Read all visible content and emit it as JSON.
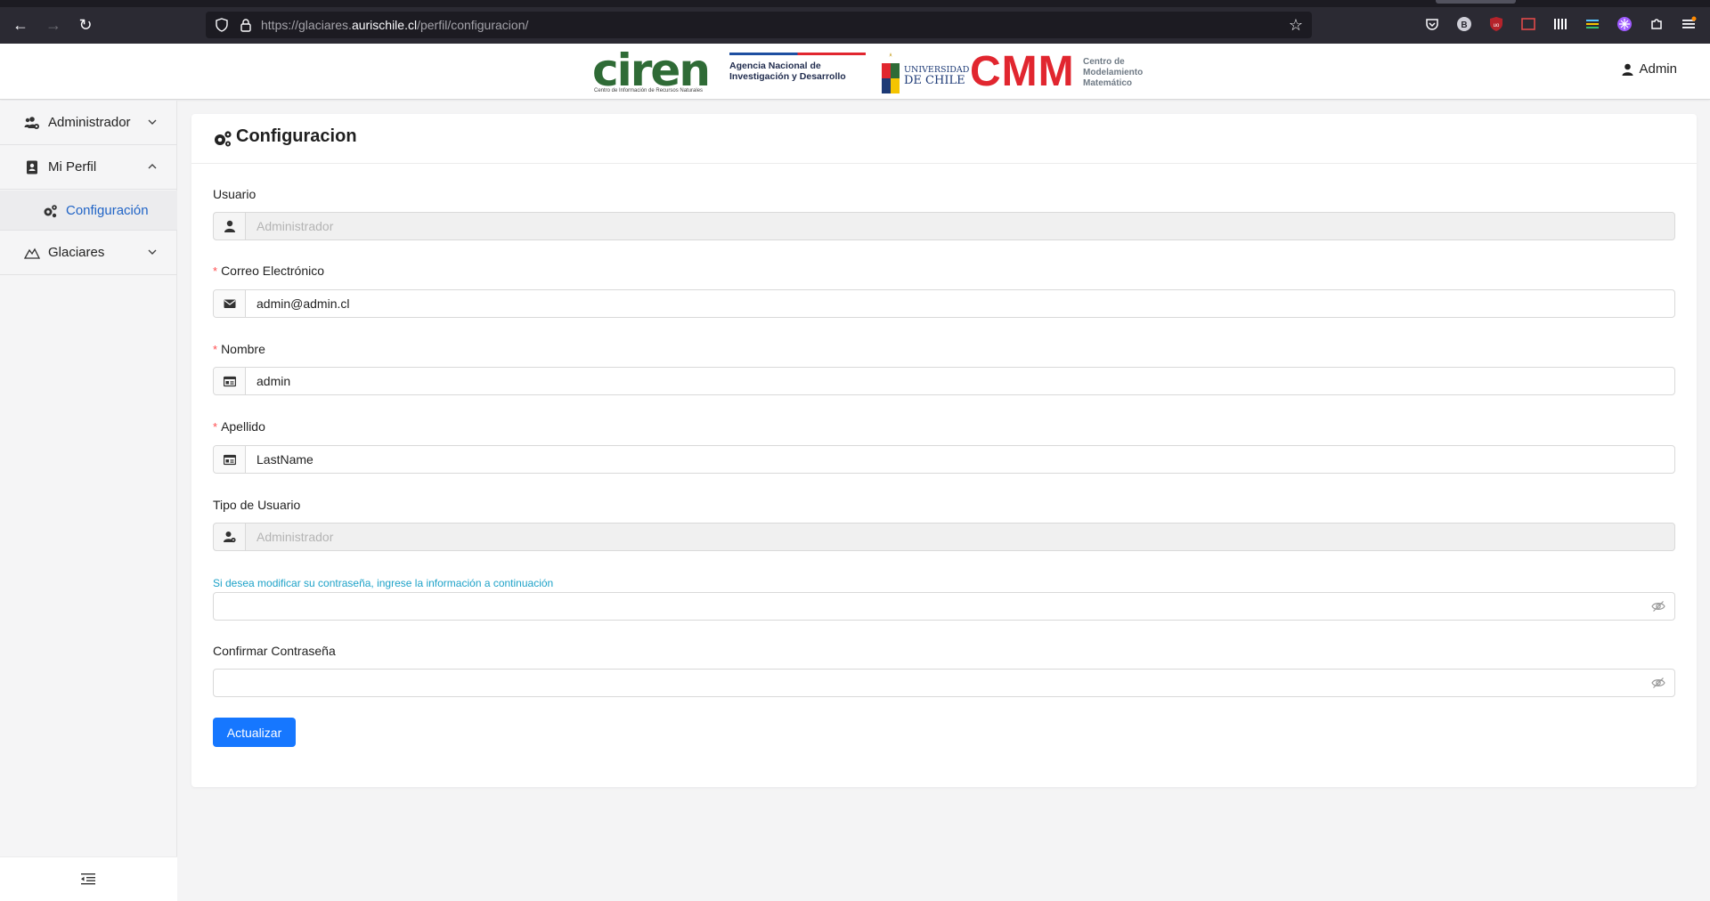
{
  "browser": {
    "url_prefix": "https://glaciares.",
    "url_domain": "aurischile.cl",
    "url_path": "/perfil/configuracion/"
  },
  "header": {
    "logo_ciren": "ciren",
    "logo_ciren_sub": "Centro de Información de Recursos Naturales",
    "logo_anid_line1": "Agencia Nacional de",
    "logo_anid_line2": "Investigación y Desarrollo",
    "logo_uchile_line1": "UNIVERSIDAD",
    "logo_uchile_line2": "DE CHILE",
    "logo_cmm": "CMM",
    "logo_cmm_line1": "Centro de",
    "logo_cmm_line2": "Modelamiento",
    "logo_cmm_line3": "Matemático",
    "user_label": "Admin"
  },
  "sidebar": {
    "items": [
      {
        "label": "Administrador"
      },
      {
        "label": "Mi Perfil"
      },
      {
        "label": "Glaciares"
      }
    ],
    "subitem": {
      "label": "Configuración"
    }
  },
  "form": {
    "title": "Configuracion",
    "usuario_label": "Usuario",
    "usuario_placeholder": "Administrador",
    "correo_label": "Correo Electrónico",
    "correo_value": "admin@admin.cl",
    "nombre_label": "Nombre",
    "nombre_value": "admin",
    "apellido_label": "Apellido",
    "apellido_value": "LastName",
    "tipo_label": "Tipo de Usuario",
    "tipo_placeholder": "Administrador",
    "password_hint": "Si desea modificar su contraseña, ingrese la información a continuación",
    "confirm_label": "Confirmar Contraseña",
    "submit_label": "Actualizar",
    "required_mark": "*"
  },
  "colors": {
    "primary": "#1677ff",
    "active_link": "#1f63c6",
    "hint": "#1ea2c8",
    "required": "#ff4d4f"
  }
}
